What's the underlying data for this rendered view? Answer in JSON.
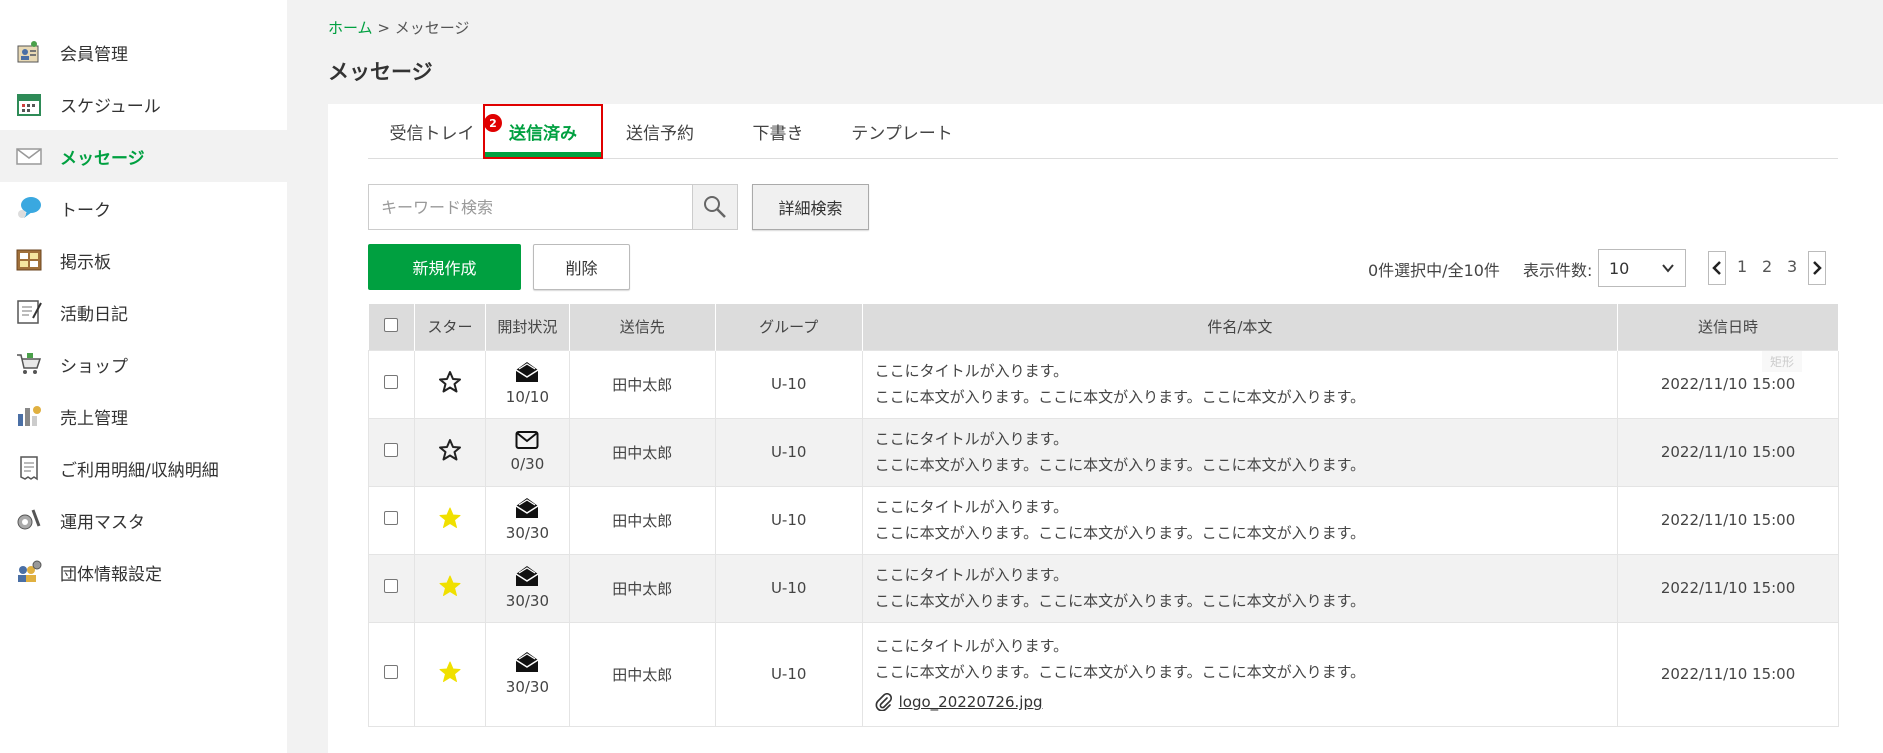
{
  "sidebar": {
    "items": [
      {
        "label": "会員管理",
        "icon": "member-icon"
      },
      {
        "label": "スケジュール",
        "icon": "calendar-icon"
      },
      {
        "label": "メッセージ",
        "icon": "envelope-icon",
        "active": true
      },
      {
        "label": "トーク",
        "icon": "chat-icon"
      },
      {
        "label": "掲示板",
        "icon": "board-icon"
      },
      {
        "label": "活動日記",
        "icon": "diary-icon"
      },
      {
        "label": "ショップ",
        "icon": "cart-icon"
      },
      {
        "label": "売上管理",
        "icon": "sales-icon"
      },
      {
        "label": "ご利用明細/収納明細",
        "icon": "receipt-icon"
      },
      {
        "label": "運用マスタ",
        "icon": "tools-icon"
      },
      {
        "label": "団体情報設定",
        "icon": "group-settings-icon"
      }
    ]
  },
  "breadcrumb": {
    "home": "ホーム",
    "sep": ">",
    "current": "メッセージ"
  },
  "page": {
    "title": "メッセージ"
  },
  "tabs": [
    {
      "label": "受信トレイ",
      "badge": "2"
    },
    {
      "label": "送信済み",
      "active": true
    },
    {
      "label": "送信予約"
    },
    {
      "label": "下書き"
    },
    {
      "label": "テンプレート"
    }
  ],
  "search": {
    "placeholder": "キーワード検索",
    "advanced_label": "詳細検索"
  },
  "actions": {
    "new_label": "新規作成",
    "delete_label": "削除"
  },
  "list_info": {
    "count_text": "0件選択中/全10件",
    "per_page_label": "表示件数:",
    "per_page_value": "10"
  },
  "pager": {
    "pages": [
      "1",
      "2",
      "3"
    ]
  },
  "table": {
    "headers": [
      "スター",
      "開封状況",
      "送信先",
      "グループ",
      "件名/本文",
      "送信日時"
    ],
    "rows": [
      {
        "starred": false,
        "opened": true,
        "open_count": "10/10",
        "to": "田中太郎",
        "group": "U-10",
        "title": "ここにタイトルが入ります。",
        "body": "ここに本文が入ります。ここに本文が入ります。ここに本文が入ります。",
        "date": "2022/11/10 15:00"
      },
      {
        "starred": false,
        "opened": false,
        "open_count": "0/30",
        "to": "田中太郎",
        "group": "U-10",
        "title": "ここにタイトルが入ります。",
        "body": "ここに本文が入ります。ここに本文が入ります。ここに本文が入ります。",
        "date": "2022/11/10 15:00"
      },
      {
        "starred": true,
        "opened": true,
        "open_count": "30/30",
        "to": "田中太郎",
        "group": "U-10",
        "title": "ここにタイトルが入ります。",
        "body": "ここに本文が入ります。ここに本文が入ります。ここに本文が入ります。",
        "date": "2022/11/10 15:00"
      },
      {
        "starred": true,
        "opened": true,
        "open_count": "30/30",
        "to": "田中太郎",
        "group": "U-10",
        "title": "ここにタイトルが入ります。",
        "body": "ここに本文が入ります。ここに本文が入ります。ここに本文が入ります。",
        "date": "2022/11/10 15:00"
      },
      {
        "starred": true,
        "opened": true,
        "open_count": "30/30",
        "to": "田中太郎",
        "group": "U-10",
        "title": "ここにタイトルが入ります。",
        "body": "ここに本文が入ります。ここに本文が入ります。ここに本文が入ります。",
        "date": "2022/11/10 15:00",
        "attachment": "logo_20220726.jpg"
      }
    ]
  },
  "overlay_label": "矩形",
  "colors": {
    "accent": "#00a040",
    "highlight": "#e00000",
    "star": "#f0e000"
  }
}
